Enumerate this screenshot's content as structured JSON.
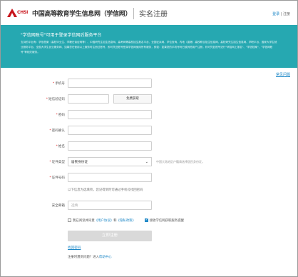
{
  "header": {
    "logo_en": "CHSI",
    "logo_cn": "中国高等教育学生信息网（学信网）",
    "page_title": "实名注册",
    "login": "登录",
    "separator": "|",
    "register": "注册"
  },
  "banner": {
    "title": "\"学信网账号\"可用于登录学信网后服务平台",
    "desc": "支持的平台有：学信档案（高校毕业生、学籍在读证明等）、中国研究生招生信息网、高考网等高校招生报名平台、全国征兵网、学位查询、内地（香港）高校联合招生信息网、高校研究生招生信息网、学职平台、国家大学生就业服务平台、全国大学生创业服务网、如果您在使用以上服务时注册过账号，即可凭此账号登录学信网使用所有服务，即如：如果您的手机号码已被其他用户注册，则可凭此账号进行\"研招网上报名\"、\"学信档案\"、\"学信网账号\"等相关服务。"
  },
  "help_top": "常见问题",
  "form": {
    "phone_label": "手机号",
    "sms_label": "短信验证码",
    "sms_button": "免费获取",
    "password_label": "密码",
    "password_confirm_label": "密码确认",
    "name_label": "姓名",
    "id_type_label": "证件类型",
    "id_type_value": "居民身份证",
    "id_type_hint": "中国大陆地区户籍请选择居民身份证。",
    "id_number_label": "证件号码",
    "note": "以下信息为选填项，您记得到时可通过手机号找回密码",
    "security_email_label": "安全邮箱",
    "security_email_placeholder": "选填",
    "agree_text": "我已阅读并同意",
    "user_agreement": "《用户协议》",
    "and": "和",
    "privacy_policy": "《隐私政策》",
    "subscribe_text": "接收学信网获取服务提醒",
    "submit": "立即注册",
    "back_link": "找回密码",
    "bottom_help_prefix": "注册时遇到问题？进入",
    "bottom_help_link": "帮助中心"
  },
  "colors": {
    "banner": "#26a8b1",
    "link": "#1e88c7",
    "required": "#e02020",
    "brand_red": "#c8161d"
  }
}
